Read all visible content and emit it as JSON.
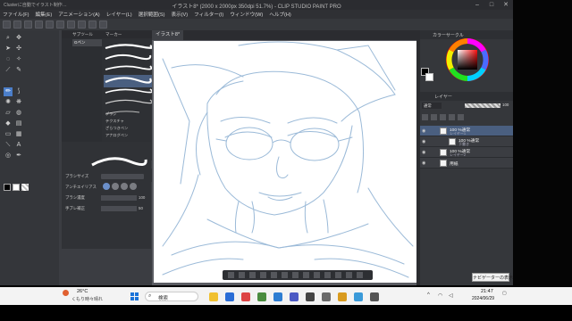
{
  "window": {
    "app_label": "Clusterに自動でイラスト制作…",
    "title": "イラスト8* (2000 x 2000px 350dpi 51.7%) - CLIP STUDIO PAINT PRO"
  },
  "menu": [
    "ファイル(F)",
    "編集(E)",
    "アニメーション(A)",
    "レイヤー(L)",
    "選択範囲(S)",
    "表示(V)",
    "フィルター(I)",
    "ウィンドウ(W)",
    "ヘルプ(H)"
  ],
  "canvas_tab": "イラスト8*",
  "subtool": {
    "header": "サブツール",
    "tabs": [
      "Gペン",
      "ミリペン",
      "マーカー"
    ],
    "items": [
      "Gペン",
      "丸ペン",
      "カブラペン",
      "リアルGペン",
      "ペン",
      "ミリペン",
      "テクスチャペン"
    ],
    "extra": [
      "ブラシ",
      "テクスチャ",
      "ざらつきペン",
      "アナログペン",
      "丸ペン(ざらつき)"
    ],
    "add_button": "サブツールを追加"
  },
  "toolprop": {
    "labels": [
      "ブラシサイズ",
      "アンチエイリアス",
      "ブラシ濃度",
      "手ブレ補正"
    ],
    "values": [
      "6.0",
      "",
      "100",
      "50"
    ]
  },
  "color_panel": {
    "header": "カラーサークル"
  },
  "layer_panel": {
    "header": "レイヤー",
    "blend_mode": "通常",
    "opacity": "100",
    "layers": [
      {
        "name": "100 %通常",
        "sub": "レイヤー1",
        "selected": true
      },
      {
        "name": "100 %通常",
        "sub": "下書き",
        "selected": false
      },
      {
        "name": "100 %通常",
        "sub": "レイヤー2",
        "selected": false
      },
      {
        "name": "用紙",
        "sub": "",
        "selected": false
      }
    ]
  },
  "tooltip": "ナビゲーターの表示",
  "taskbar": {
    "weather_temp": "26°C",
    "weather_desc": "くもり時々晴れ",
    "search_placeholder": "検索",
    "time": "21:47",
    "date": "2024/06/29"
  },
  "colors": {
    "accent": "#4b7ec9",
    "sketch": "#9bbad8",
    "selected_layer": "#4a5f80"
  }
}
